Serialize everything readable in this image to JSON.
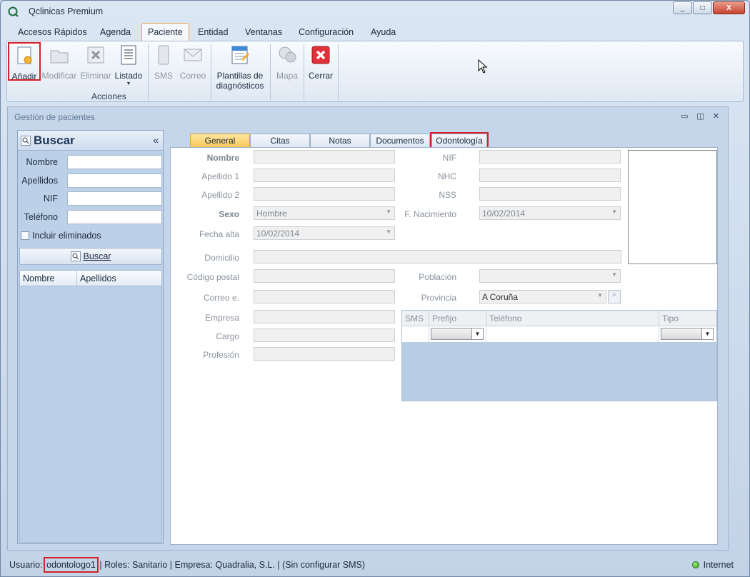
{
  "window": {
    "title": "Qclinicas Premium",
    "controls": [
      "_",
      "□",
      "X"
    ]
  },
  "menu": {
    "tabs": [
      "Accesos Rápidos",
      "Agenda",
      "Paciente",
      "Entidad",
      "Ventanas",
      "Configuración",
      "Ayuda"
    ],
    "active": "Paciente"
  },
  "ribbon": {
    "add": "Añadir",
    "modify": "Modificar",
    "delete": "Eliminar",
    "list": "Listado",
    "sms": "SMS",
    "mail": "Correo",
    "templates_1": "Plantillas de",
    "templates_2": "diagnósticos",
    "map": "Mapa",
    "close": "Cerrar",
    "group_actions": "Acciones"
  },
  "child": {
    "title": "Gestión de pacientes"
  },
  "search": {
    "title": "Buscar",
    "fields": {
      "nombre": "Nombre",
      "apellidos": "Apellidos",
      "nif": "NIF",
      "telefono": "Teléfono"
    },
    "include_deleted": "Incluir eliminados",
    "button": "Buscar",
    "columns": [
      "Nombre",
      "Apellidos"
    ]
  },
  "tabs": [
    "General",
    "Citas",
    "Notas",
    "Documentos",
    "Odontología"
  ],
  "form": {
    "labels": {
      "nombre": "Nombre",
      "apellido1": "Apellido 1",
      "apellido2": "Apellido 2",
      "sexo": "Sexo",
      "fecha_alta": "Fecha alta",
      "domicilio": "Domicilio",
      "codigo_postal": "Código postal",
      "correo": "Correo e.",
      "empresa": "Empresa",
      "cargo": "Cargo",
      "profesion": "Profesión",
      "nif": "NIF",
      "nhc": "NHC",
      "nss": "NSS",
      "f_nacimiento": "F. Nacimiento",
      "poblacion": "Población",
      "provincia": "Provincia"
    },
    "values": {
      "sexo": "Hombre",
      "fecha_alta": "10/02/2014",
      "f_nacimiento": "10/02/2014",
      "provincia": "A Coruña"
    },
    "phones_columns": [
      "SMS",
      "Prefijo",
      "Teléfono",
      "Tipo"
    ]
  },
  "status": {
    "user_label": "Usuario:",
    "user": "odontologo1",
    "rest": "| Roles: Sanitario | Empresa: Quadralia, S.L. | (Sin configurar SMS)",
    "zone": "Internet"
  }
}
